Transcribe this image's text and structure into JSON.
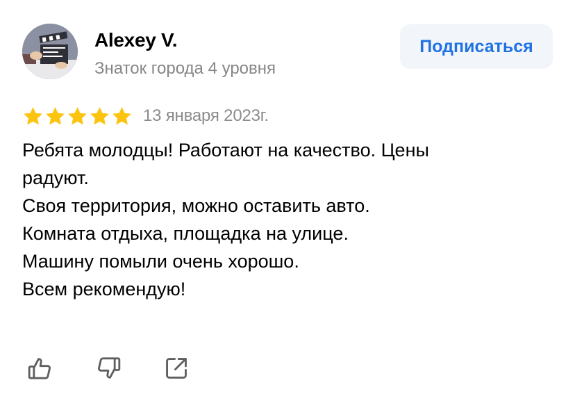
{
  "author": {
    "name": "Alexey V.",
    "level": "Знаток города 4 уровня"
  },
  "subscribe_label": "Подписаться",
  "rating": {
    "value": 5,
    "max": 5,
    "star_color": "#fcc40f"
  },
  "date": "13 января 2023г.",
  "review_lines": [
    "Ребята молодцы! Работают на качество. Цены",
    "радуют.",
    "Своя территория, можно оставить авто.",
    "Комната отдыха, площадка на улице.",
    "Машину помыли очень хорошо.",
    "Всем рекомендую!"
  ],
  "actions": [
    {
      "icon": "thumb-up-icon"
    },
    {
      "icon": "thumb-down-icon"
    },
    {
      "icon": "share-icon"
    }
  ],
  "colors": {
    "accent": "#1f72e4",
    "button_bg": "#f2f5fa",
    "muted_text": "#868686",
    "icon": "#5f5f5f"
  }
}
